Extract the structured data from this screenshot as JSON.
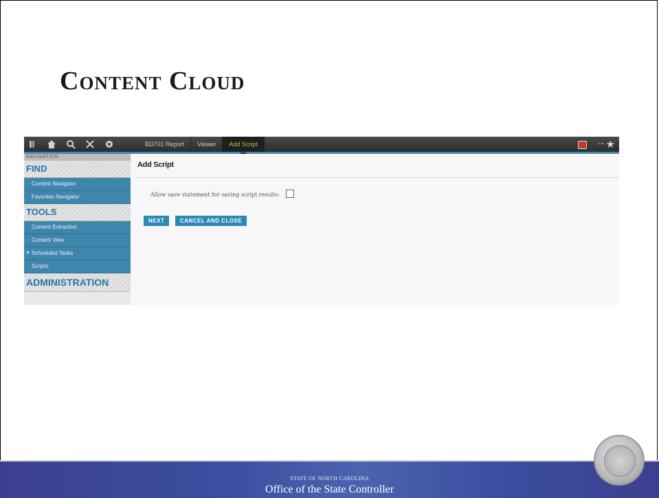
{
  "slide": {
    "title": "Content Cloud"
  },
  "app": {
    "topbar": {
      "icons": [
        "menu-icon",
        "home-icon",
        "search-icon",
        "tools-icon",
        "settings-icon"
      ],
      "tabs": [
        {
          "label": "BD701 Report",
          "active": false
        },
        {
          "label": "Viewer",
          "active": false
        },
        {
          "label": "Add Script",
          "active": true
        }
      ],
      "accent_color": "#3c8ab0",
      "active_tab_color": "#a8c83a"
    },
    "sidebar": {
      "caption": "NAVIGATION",
      "sections": [
        {
          "heading": "FIND",
          "items": [
            "Content Navigator",
            "Favorites Navigator"
          ]
        },
        {
          "heading": "TOOLS",
          "items": [
            "Content Extraction",
            "Content View",
            "Scheduled Tasks",
            "Scripts"
          ]
        },
        {
          "heading": "ADMINISTRATION",
          "items": []
        }
      ]
    },
    "main": {
      "title": "Add Script",
      "option_label": "Allow save statement for saving script results:",
      "option_checked": false,
      "buttons": {
        "next": "NEXT",
        "cancel": "CANCEL AND CLOSE"
      },
      "button_color": "#2d8ab5"
    }
  },
  "footer": {
    "line1": "STATE OF NORTH CAROLINA",
    "line2": "Office of the State Controller"
  }
}
